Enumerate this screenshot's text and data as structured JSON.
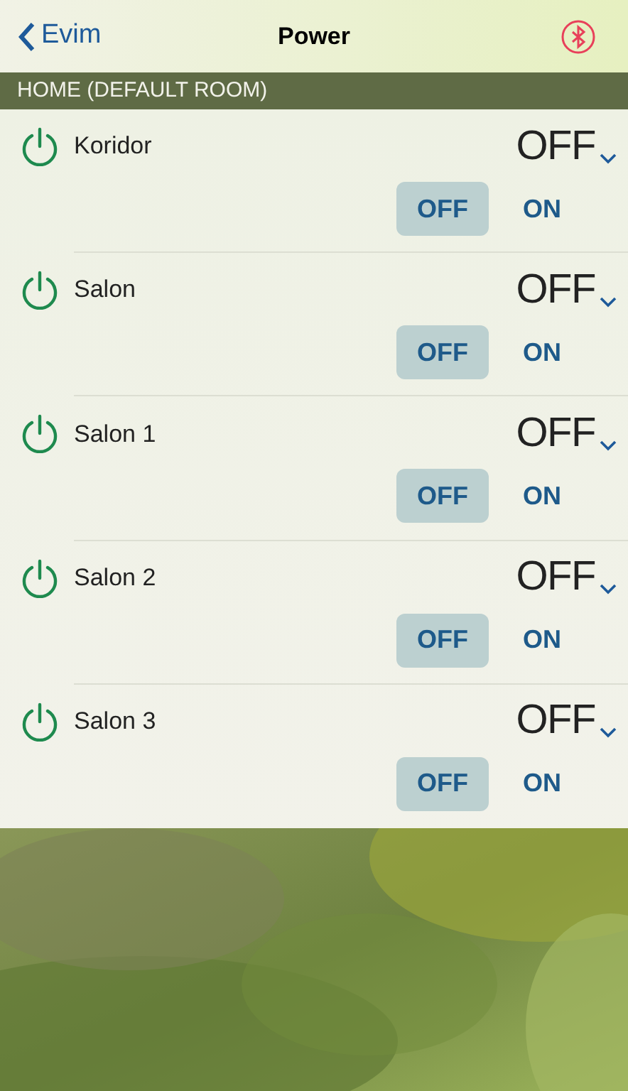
{
  "nav": {
    "back_label": "Evim",
    "title": "Power"
  },
  "section": {
    "title": "HOME (DEFAULT ROOM)"
  },
  "devices": [
    {
      "name": "Koridor",
      "value": "OFF",
      "options": [
        {
          "label": "OFF",
          "selected": true
        },
        {
          "label": "ON",
          "selected": false
        }
      ]
    },
    {
      "name": "Salon",
      "value": "OFF",
      "options": [
        {
          "label": "OFF",
          "selected": true
        },
        {
          "label": "ON",
          "selected": false
        }
      ]
    },
    {
      "name": "Salon 1",
      "value": "OFF",
      "options": [
        {
          "label": "OFF",
          "selected": true
        },
        {
          "label": "ON",
          "selected": false
        }
      ]
    },
    {
      "name": "Salon 2",
      "value": "OFF",
      "options": [
        {
          "label": "OFF",
          "selected": true
        },
        {
          "label": "ON",
          "selected": false
        }
      ]
    },
    {
      "name": "Salon 3",
      "value": "OFF",
      "options": [
        {
          "label": "OFF",
          "selected": true
        },
        {
          "label": "ON",
          "selected": false
        }
      ]
    }
  ]
}
